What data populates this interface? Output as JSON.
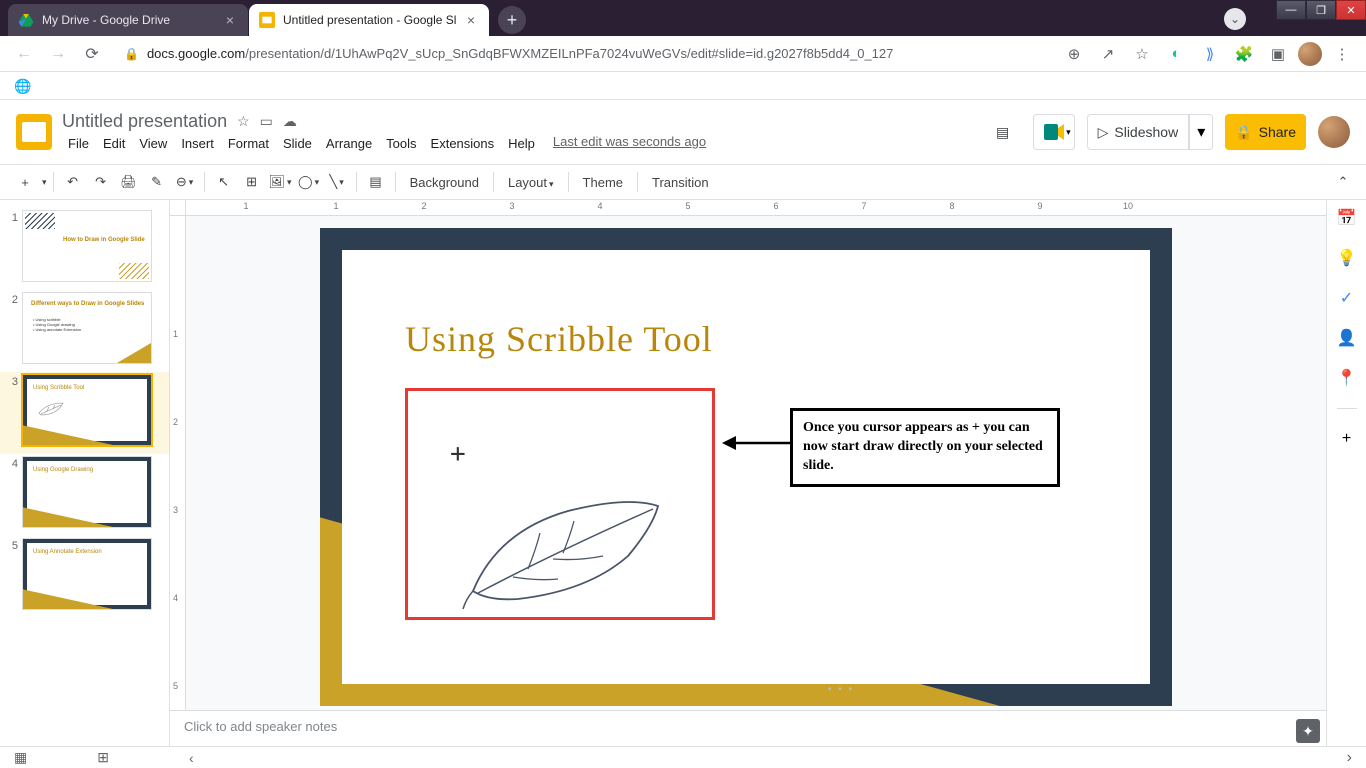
{
  "window": {
    "min": "—",
    "max": "❐",
    "close": "✕"
  },
  "tabs": [
    {
      "title": "My Drive - Google Drive",
      "favicon_color1": "#0f9d58",
      "favicon_color2": "#4285f4",
      "favicon_color3": "#fbbc04"
    },
    {
      "title": "Untitled presentation - Google Sl",
      "favicon_color": "#f4b400"
    }
  ],
  "newtab": "+",
  "address": {
    "lock": "🔒",
    "domain": "docs.google.com",
    "path": "/presentation/d/1UhAwPq2V_sUcp_SnGdqBFWXMZEILnPFa7024vuWeGVs/edit#slide=id.g2027f8b5dd4_0_127"
  },
  "addr_icons": {
    "zoom": "⊕",
    "share": "↗",
    "star": "☆",
    "green": "◐",
    "cast": "⟫",
    "ext": "🧩",
    "panel": "▣",
    "menu": "⋮"
  },
  "doc": {
    "title": "Untitled presentation",
    "star": "☆",
    "move": "▭",
    "cloud": "☁",
    "last_edit": "Last edit was seconds ago"
  },
  "menu": [
    "File",
    "Edit",
    "View",
    "Insert",
    "Format",
    "Slide",
    "Arrange",
    "Tools",
    "Extensions",
    "Help"
  ],
  "header_buttons": {
    "comments": "▤",
    "meet": "📹",
    "slideshow": "Slideshow",
    "slideshow_icon": "▷",
    "share": "Share",
    "share_icon": "🔒"
  },
  "toolbar": {
    "newslide": "+",
    "undo": "↶",
    "redo": "↷",
    "print": "🖨",
    "paint": "✎",
    "zoom": "⊖",
    "select": "↖",
    "textbox": "⊞",
    "image": "🖼",
    "shape": "◯",
    "line": "╲",
    "comment": "▤",
    "background": "Background",
    "layout": "Layout",
    "theme": "Theme",
    "transition": "Transition",
    "collapse": "⌃"
  },
  "ruler_labels": [
    "1",
    "2",
    "1",
    "2",
    "3",
    "4",
    "5",
    "6",
    "7",
    "8",
    "9",
    "10"
  ],
  "slides": [
    {
      "title": "How to Draw in Google Slide"
    },
    {
      "title": "Different ways to Draw in Google Slides",
      "bullets": [
        "Using scribble",
        "Using Google drawing",
        "Using annotate Extension"
      ]
    },
    {
      "title": "Using Scribble Tool"
    },
    {
      "title": "Using Google Drawing"
    },
    {
      "title": "Using Annotate Extension"
    }
  ],
  "current_slide": {
    "heading": "Using Scribble Tool",
    "callout": "Once you cursor appears as + you can now start draw directly on your selected slide.",
    "cursor": "+"
  },
  "notes_placeholder": "Click to add speaker notes",
  "sidepanel": {
    "calendar": "📅",
    "keep": "💡",
    "tasks": "✓",
    "contacts": "👤",
    "maps": "📍",
    "plus": "+"
  },
  "bottombar": {
    "filmstrip": "▦",
    "grid": "⊞",
    "collapse": "‹",
    "expand": "›"
  }
}
